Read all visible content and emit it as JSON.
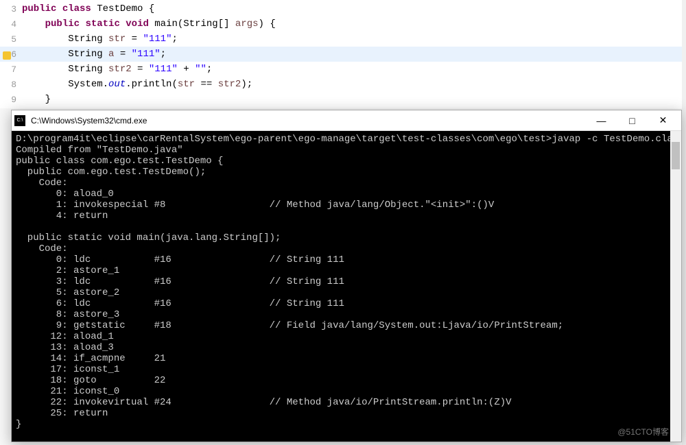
{
  "editor": {
    "lines": [
      {
        "num": "3",
        "html": "<span class='kw'>public</span> <span class='kw'>class</span> TestDemo {"
      },
      {
        "num": "4",
        "marker": "collapse",
        "html": "    <span class='kw'>public</span> <span class='kw'>static</span> <span class='kw'>void</span> main(String[] <span class='var'>args</span>) {"
      },
      {
        "num": "5",
        "html": "        String <span class='var'>str</span> = <span class='str'>\"111\"</span>;"
      },
      {
        "num": "6",
        "highlighted": true,
        "warn": true,
        "html": "        String <span class='var'>a</span> = <span class='str'>\"111\"</span>;"
      },
      {
        "num": "7",
        "html": "        String <span class='var'>str2</span> = <span class='str'>\"111\"</span> + <span class='str'>\"\"</span>;"
      },
      {
        "num": "8",
        "html": "        System.<span class='field'>out</span>.println(<span class='var'>str</span> == <span class='var'>str2</span>);"
      },
      {
        "num": "9",
        "html": "    }"
      }
    ]
  },
  "console": {
    "title": "C:\\Windows\\System32\\cmd.exe",
    "minimize": "—",
    "maximize": "□",
    "close": "✕",
    "output": "D:\\program4it\\eclipse\\carRentalSystem\\ego-parent\\ego-manage\\target\\test-classes\\com\\ego\\test>javap -c TestDemo.class\nCompiled from \"TestDemo.java\"\npublic class com.ego.test.TestDemo {\n  public com.ego.test.TestDemo();\n    Code:\n       0: aload_0\n       1: invokespecial #8                  // Method java/lang/Object.\"<init>\":()V\n       4: return\n\n  public static void main(java.lang.String[]);\n    Code:\n       0: ldc           #16                 // String 111\n       2: astore_1\n       3: ldc           #16                 // String 111\n       5: astore_2\n       6: ldc           #16                 // String 111\n       8: astore_3\n       9: getstatic     #18                 // Field java/lang/System.out:Ljava/io/PrintStream;\n      12: aload_1\n      13: aload_3\n      14: if_acmpne     21\n      17: iconst_1\n      18: goto          22\n      21: iconst_0\n      22: invokevirtual #24                 // Method java/io/PrintStream.println:(Z)V\n      25: return\n}"
  },
  "watermark": "@51CTO博客"
}
